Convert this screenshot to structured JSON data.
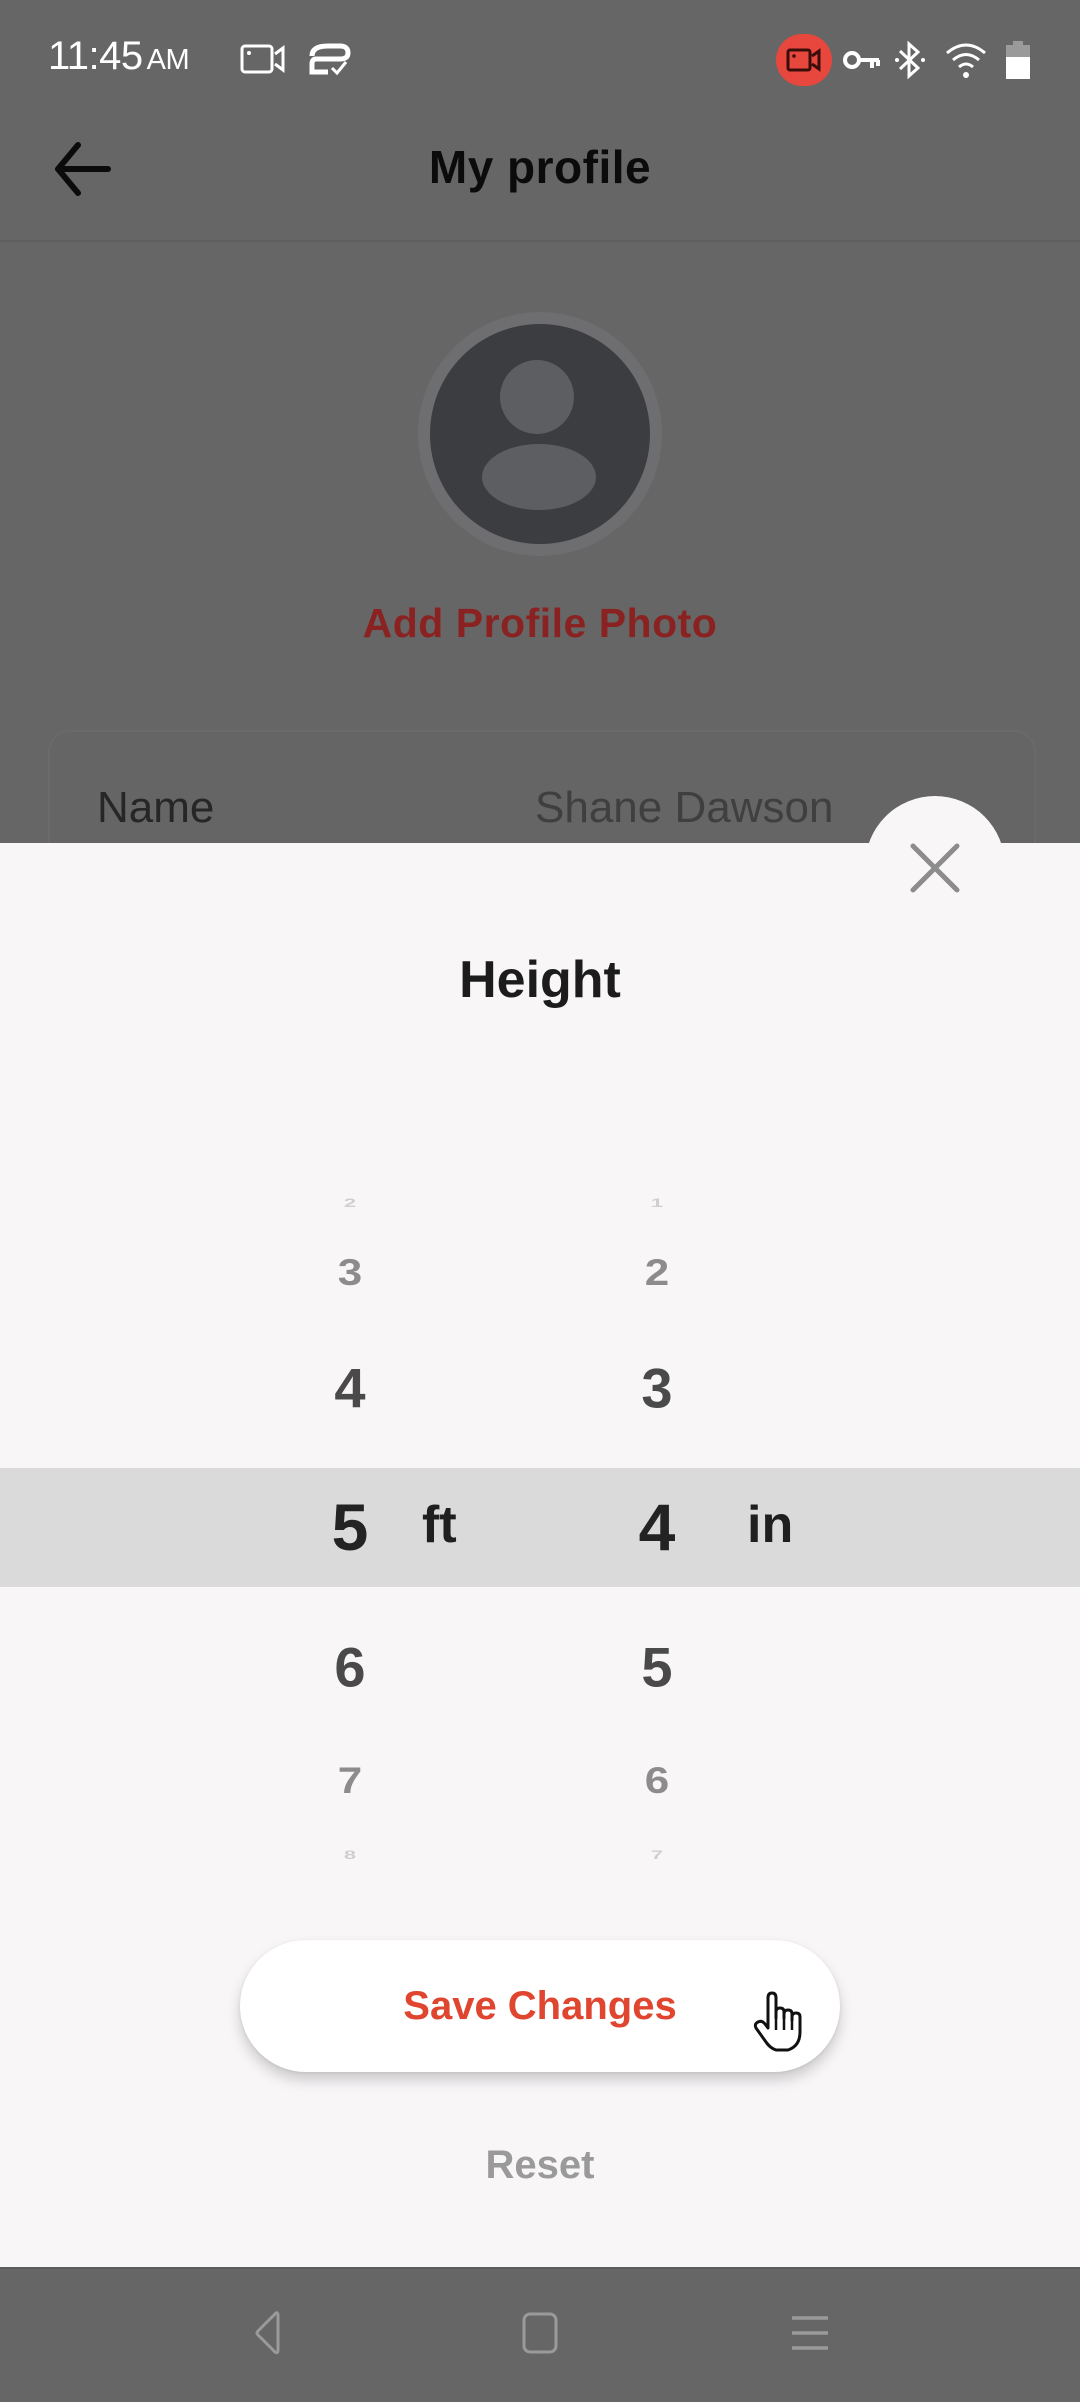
{
  "status_bar": {
    "time": "11:45",
    "ampm": "AM",
    "left_icons": [
      "screen-record-icon",
      "cast-check-icon"
    ],
    "right_icons": [
      "recording-active-icon",
      "vpn-key-icon",
      "bluetooth-icon",
      "wifi-icon",
      "battery-icon"
    ],
    "recording_color": "#e8473e"
  },
  "header": {
    "title": "My profile",
    "back_icon": "arrow-left-icon"
  },
  "profile": {
    "add_photo_label": "Add Profile Photo",
    "fields": [
      {
        "label": "Name",
        "value": "Shane Dawson"
      }
    ]
  },
  "sheet": {
    "title": "Height",
    "close_icon": "close-icon",
    "picker": {
      "feet": {
        "unit": "ft",
        "visible_values": [
          "2",
          "3",
          "4",
          "5",
          "6",
          "7",
          "8"
        ],
        "selected": "5"
      },
      "inches": {
        "unit": "in",
        "visible_values": [
          "1",
          "2",
          "3",
          "4",
          "5",
          "6",
          "7"
        ],
        "selected": "4"
      }
    },
    "save_label": "Save Changes",
    "reset_label": "Reset",
    "accent_color": "#e04530"
  },
  "nav_bar": {
    "icons": [
      "nav-back-icon",
      "nav-home-icon",
      "nav-menu-icon"
    ]
  }
}
